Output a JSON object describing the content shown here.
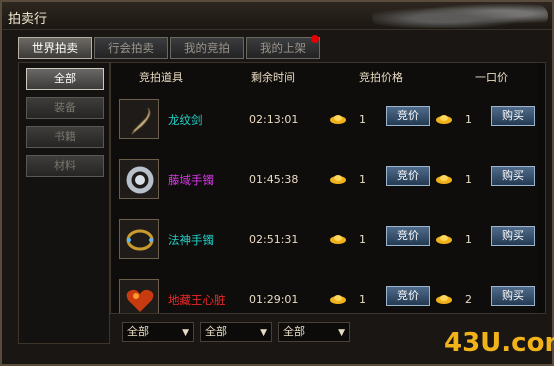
{
  "window_title": "拍卖行",
  "tabs": [
    {
      "label": "世界拍卖",
      "active": true
    },
    {
      "label": "行会拍卖",
      "active": false
    },
    {
      "label": "我的竞拍",
      "active": false
    },
    {
      "label": "我的上架",
      "active": false,
      "notify_dot": true
    }
  ],
  "categories": [
    {
      "label": "全部",
      "active": true
    },
    {
      "label": "装备",
      "active": false
    },
    {
      "label": "书籍",
      "active": false
    },
    {
      "label": "材料",
      "active": false
    }
  ],
  "table_headers": [
    "竞拍道具",
    "剩余时间",
    "竞拍价格",
    "一口价"
  ],
  "items": [
    {
      "name": "龙纹剑",
      "name_color": "#22d0c8",
      "time": "02:13:01",
      "bid_price": "1",
      "bid_label": "竞价",
      "buyout_price": "1",
      "buy_label": "购买",
      "icon": "sword-icon"
    },
    {
      "name": "藤域手镯",
      "name_color": "#d838e8",
      "time": "01:45:38",
      "bid_price": "1",
      "bid_label": "竞价",
      "buyout_price": "1",
      "buy_label": "购买",
      "icon": "bracelet-icon"
    },
    {
      "name": "法神手镯",
      "name_color": "#22d0c8",
      "time": "02:51:31",
      "bid_price": "1",
      "bid_label": "竞价",
      "buyout_price": "1",
      "buy_label": "购买",
      "icon": "ring-icon"
    },
    {
      "name": "地藏王心脏",
      "name_color": "#e82828",
      "time": "01:29:01",
      "bid_price": "1",
      "bid_label": "竞价",
      "buyout_price": "2",
      "buy_label": "购买",
      "icon": "heart-icon"
    }
  ],
  "filters": [
    {
      "value": "全部"
    },
    {
      "value": "全部"
    },
    {
      "value": "全部"
    }
  ],
  "watermark": "43U.com",
  "colors": {
    "gold": "#f2b21a",
    "button_blue": "#3a5675"
  }
}
